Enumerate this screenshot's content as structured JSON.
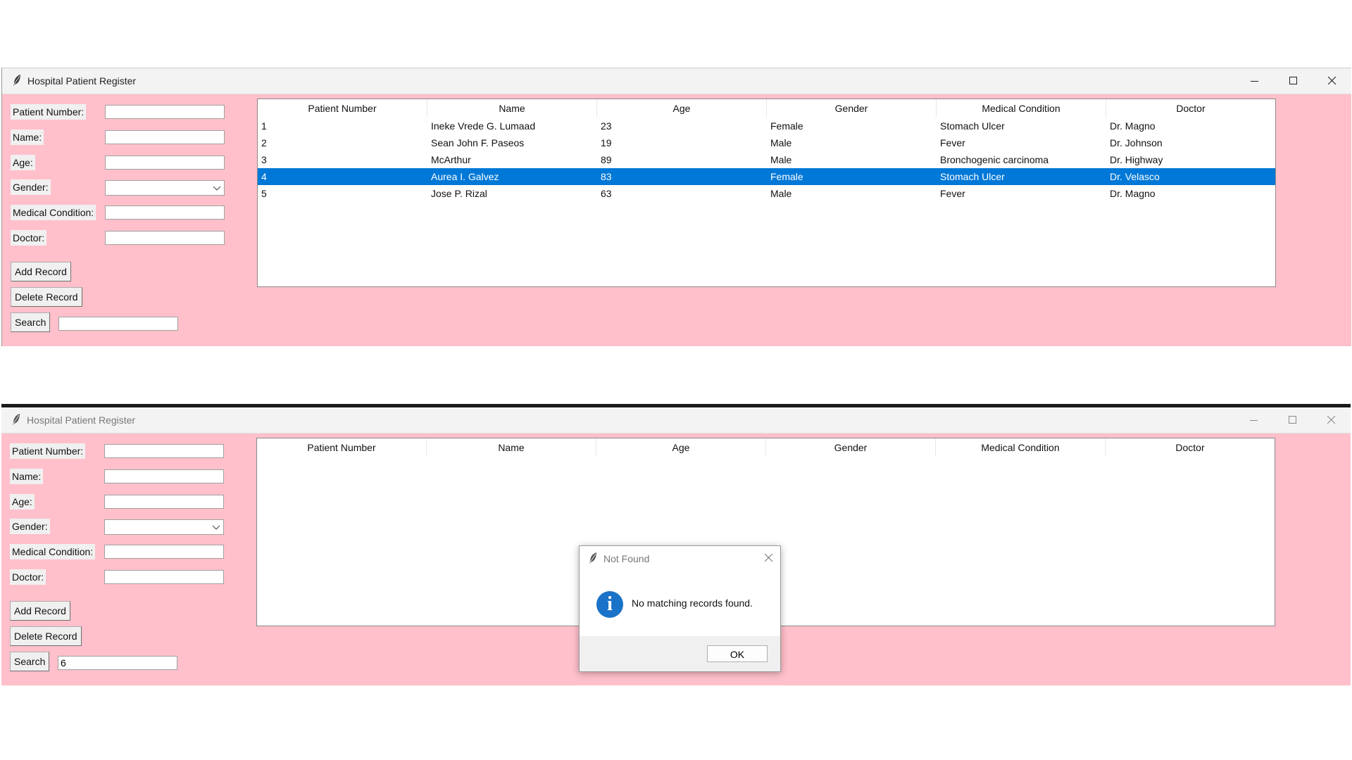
{
  "window": {
    "title": "Hospital Patient Register"
  },
  "form": {
    "labels": {
      "patient_number": "Patient Number:",
      "name": "Name:",
      "age": "Age:",
      "gender": "Gender:",
      "medical_condition": "Medical Condition:",
      "doctor": "Doctor:"
    },
    "buttons": {
      "add": "Add Record",
      "delete": "Delete Record",
      "search": "Search"
    }
  },
  "table": {
    "columns": [
      "Patient Number",
      "Name",
      "Age",
      "Gender",
      "Medical Condition",
      "Doctor"
    ],
    "rows": [
      [
        "1",
        "Ineke Vrede G. Lumaad",
        "23",
        "Female",
        "Stomach Ulcer",
        "Dr. Magno"
      ],
      [
        "2",
        "Sean John F. Paseos",
        "19",
        "Male",
        "Fever",
        "Dr. Johnson"
      ],
      [
        "3",
        "McArthur",
        "89",
        "Male",
        "Bronchogenic carcinoma",
        "Dr. Highway"
      ],
      [
        "4",
        "Aurea I. Galvez",
        "83",
        "Female",
        "Stomach Ulcer",
        "Dr. Velasco"
      ],
      [
        "5",
        "Jose P. Rizal",
        "63",
        "Male",
        "Fever",
        "Dr. Magno"
      ]
    ],
    "selected_row": 4
  },
  "window2": {
    "search_value": "6"
  },
  "dialog": {
    "title": "Not Found",
    "message": "No matching records found.",
    "ok": "OK"
  },
  "colors": {
    "background": "#ffc0cb",
    "selection": "#0078d7",
    "info_icon": "#1a73c8"
  }
}
